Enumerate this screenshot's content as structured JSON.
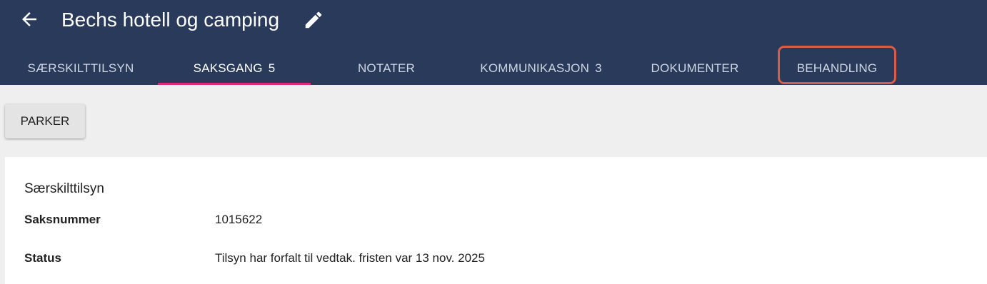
{
  "header": {
    "title": "Bechs hotell og camping",
    "back_icon": "arrow-left-icon",
    "edit_icon": "pencil-icon",
    "background": "#293a5a"
  },
  "tabs": [
    {
      "label": "SÆRSKILTTILSYN",
      "count": ""
    },
    {
      "label": "SAKSGANG",
      "count": "5",
      "active": true
    },
    {
      "label": "NOTATER",
      "count": ""
    },
    {
      "label": "KOMMUNIKASJON",
      "count": "3"
    },
    {
      "label": "DOKUMENTER",
      "count": ""
    },
    {
      "label": "BEHANDLING",
      "count": "",
      "highlighted": true
    }
  ],
  "accent_color": "#e0287a",
  "highlight_color": "#d85c47",
  "toolbar": {
    "park_label": "PARKER"
  },
  "details": {
    "section_title": "Særskilttilsyn",
    "rows": [
      {
        "label": "Saksnummer",
        "value": "1015622"
      },
      {
        "label": "Status",
        "value": "Tilsyn har forfalt til vedtak. fristen var 13 nov. 2025"
      }
    ]
  }
}
